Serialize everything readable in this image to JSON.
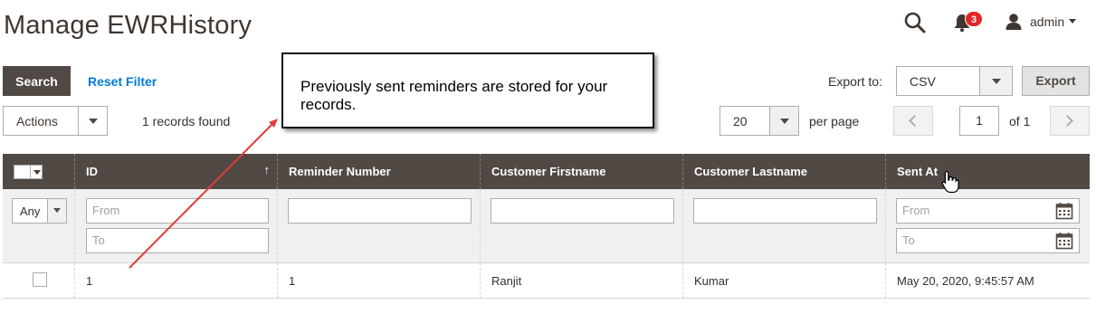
{
  "page": {
    "title": "Manage EWRHistory"
  },
  "header": {
    "notifications_count": "3",
    "user_name": "admin"
  },
  "toolbar": {
    "search_label": "Search",
    "reset_filter_label": "Reset Filter",
    "actions_label": "Actions",
    "records_found": "1 records found",
    "export_to_label": "Export to:",
    "export_format": "CSV",
    "export_button": "Export",
    "per_page_value": "20",
    "per_page_label": "per page",
    "current_page": "1",
    "page_of": "of 1"
  },
  "callout": {
    "text": "Previously sent reminders are stored for your records."
  },
  "grid": {
    "columns": [
      "ID",
      "Reminder Number",
      "Customer Firstname",
      "Customer Lastname",
      "Sent At"
    ],
    "sort_indicator": "↑",
    "filters": {
      "any_label": "Any",
      "id_from_placeholder": "From",
      "id_to_placeholder": "To",
      "sent_from_placeholder": "From",
      "sent_to_placeholder": "To"
    },
    "rows": [
      {
        "id": "1",
        "reminder_number": "1",
        "firstname": "Ranjit",
        "lastname": "Kumar",
        "sent_at": "May 20, 2020, 9:45:57 AM"
      }
    ]
  },
  "colors": {
    "header_bg": "#514943",
    "link": "#007bdb",
    "badge": "#e22626",
    "annotation_arrow": "#e03c3c"
  }
}
